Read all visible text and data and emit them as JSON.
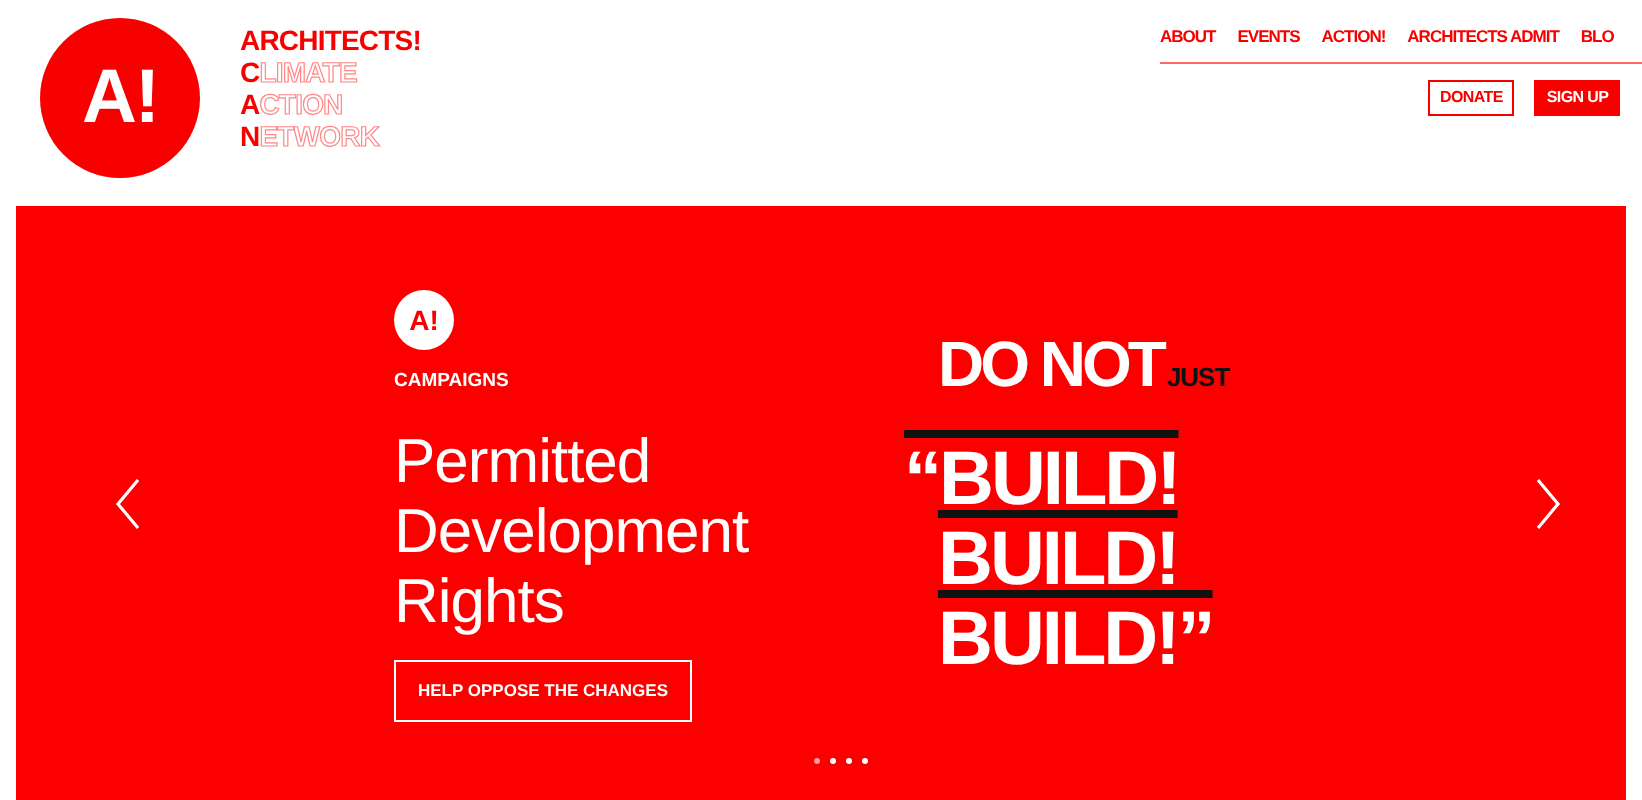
{
  "logo": {
    "mark": "A!",
    "wordmark": [
      {
        "initial": "ARCHITECTS!"
      },
      {
        "initial": "C",
        "rest": "LIMATE"
      },
      {
        "initial": "A",
        "rest": "CTION"
      },
      {
        "initial": "N",
        "rest": "ETWORK"
      }
    ]
  },
  "nav": [
    "ABOUT",
    "EVENTS",
    "ACTION!",
    "ARCHITECTS ADMIT",
    "BLO"
  ],
  "header_buttons": [
    {
      "label": "DONATE",
      "kind": "outline"
    },
    {
      "label": "SIGN UP",
      "kind": "solid"
    }
  ],
  "slide": {
    "mark": "A!",
    "category": "CAMPAIGNS",
    "title_lines": [
      "Permitted",
      "Development",
      "Rights"
    ],
    "button": "HELP OPPOSE THE CHANGES",
    "poster": {
      "heading": "DO NOT",
      "aside": "JUST",
      "lines": [
        "“BUILD!",
        "BUILD!",
        "BUILD!”"
      ]
    }
  },
  "indicators": [
    {
      "selected": true
    },
    {
      "selected": false
    },
    {
      "selected": false
    },
    {
      "selected": false
    }
  ]
}
